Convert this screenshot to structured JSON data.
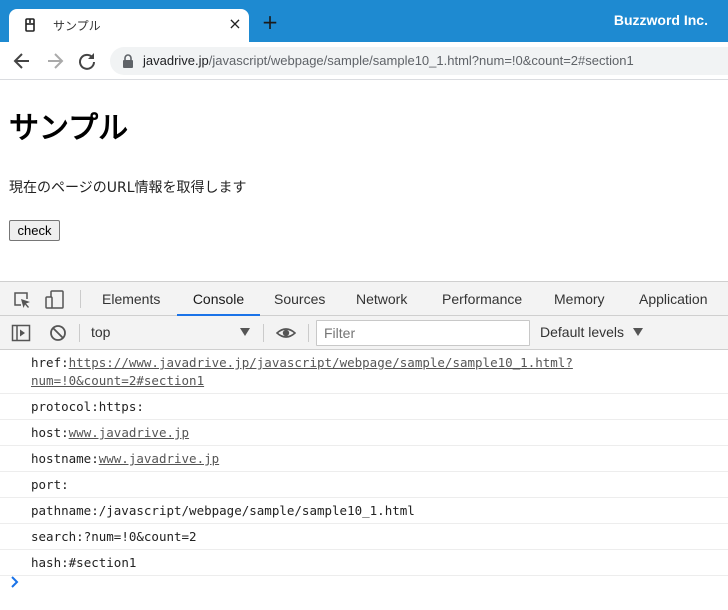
{
  "browser": {
    "tab_title": "サンプル",
    "tab_close": "×",
    "new_tab": "+",
    "brand": "Buzzword Inc.",
    "url_host": "javadrive.jp",
    "url_path": "/javascript/webpage/sample/sample10_1.html?num=!0&count=2#section1"
  },
  "page": {
    "title": "サンプル",
    "description": "現在のページのURL情報を取得します",
    "check_button": "check"
  },
  "devtools": {
    "tabs": [
      "Elements",
      "Console",
      "Sources",
      "Network",
      "Performance",
      "Memory",
      "Application"
    ],
    "active_tab": "Console",
    "context": "top",
    "filter_placeholder": "Filter",
    "levels": "Default levels"
  },
  "console": {
    "rows": [
      {
        "label": "href:",
        "value": "https://www.javadrive.jp/javascript/webpage/sample/sample10_1.html?num=!0&count=2#section1",
        "link": true
      },
      {
        "label": "protocol:",
        "value": "https:",
        "link": false
      },
      {
        "label": "host:",
        "value": "www.javadrive.jp",
        "link": true
      },
      {
        "label": "hostname:",
        "value": "www.javadrive.jp",
        "link": true
      },
      {
        "label": "port:",
        "value": "",
        "link": false
      },
      {
        "label": "pathname:",
        "value": "/javascript/webpage/sample/sample10_1.html",
        "link": false
      },
      {
        "label": "search:",
        "value": "?num=!0&count=2",
        "link": false
      },
      {
        "label": "hash:",
        "value": "#section1",
        "link": false
      }
    ]
  },
  "colors": {
    "tabbar": "#1e8ad1",
    "devtools_accent": "#1a73e8",
    "prompt": "#1a73e8"
  },
  "icons": [
    "page-favicon-icon",
    "back-icon",
    "forward-icon",
    "reload-icon",
    "lock-icon",
    "inspect-icon",
    "device-icon",
    "sidebar-icon",
    "clear-console-icon",
    "eye-icon",
    "prompt-chevron-icon"
  ]
}
